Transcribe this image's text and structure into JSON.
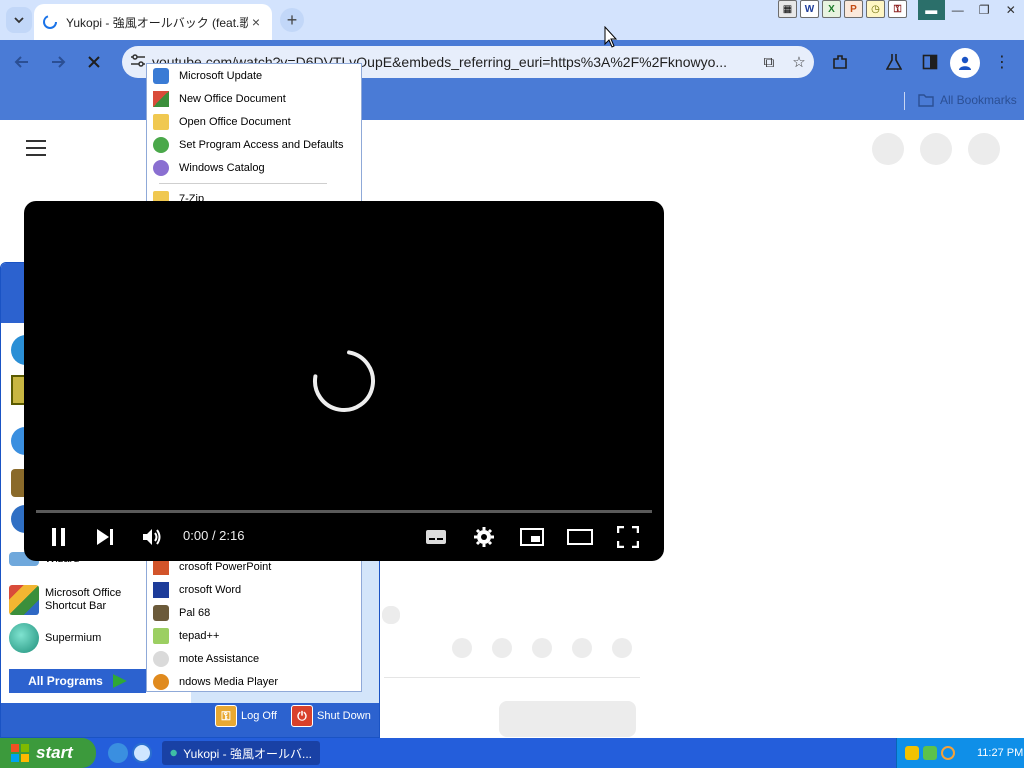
{
  "browser": {
    "tab": {
      "title": "Yukopi - 強風オールバック (feat.歌愛",
      "close": "×"
    },
    "new_tab": "+",
    "url": "youtube.com/watch?v=D6DVTLvOupE&embeds_referring_euri=https%3A%2F%2Fknowyo...",
    "bookmarks": {
      "all_label": "All Bookmarks"
    }
  },
  "start_menu": {
    "pinned": [
      {
        "label": "Wizard"
      },
      {
        "label": "Microsoft Office Shortcut Bar"
      },
      {
        "label": "Supermium"
      }
    ],
    "all_programs": "All Programs",
    "log_off": "Log Off",
    "shut_down": "Shut Down",
    "programs_top": [
      {
        "label": "Microsoft Update",
        "icon": "windows-update-icon"
      },
      {
        "label": "New Office Document",
        "icon": "office-doc-icon"
      },
      {
        "label": "Open Office Document",
        "icon": "folder-doc-icon"
      },
      {
        "label": "Set Program Access and Defaults",
        "icon": "program-access-icon"
      },
      {
        "label": "Windows Catalog",
        "icon": "catalog-icon"
      },
      {
        "label": "7-Zip",
        "icon": "folder-icon"
      }
    ],
    "programs_bottom": [
      {
        "label": "crosoft PowerPoint",
        "icon": "powerpoint-icon"
      },
      {
        "label": "crosoft Word",
        "icon": "word-icon"
      },
      {
        "label": "Pal 68",
        "icon": "mspal-icon"
      },
      {
        "label": "tepad++",
        "icon": "notepadpp-icon"
      },
      {
        "label": "mote Assistance",
        "icon": "remote-assistance-icon"
      },
      {
        "label": "ndows Media Player",
        "icon": "media-player-icon"
      }
    ]
  },
  "player": {
    "time_current": "0:00",
    "time_total": "2:16",
    "progress": 0
  },
  "taskbar": {
    "start": "start",
    "task_title": "Yukopi - 強風オールバ...",
    "clock": "11:27 PM"
  },
  "colors": {
    "toolbar": "#4a7bd6",
    "xp_blue": "#245edb",
    "start_green": "#3c9a3c",
    "player_bg": "#000000"
  }
}
